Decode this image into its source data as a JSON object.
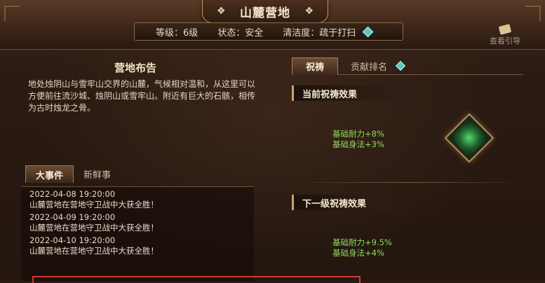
{
  "header": {
    "title": "山麓营地",
    "level": "等级：6级",
    "state": "状态：安全",
    "cleanliness": "清洁度：疏于打扫",
    "view_guide": "查看引导"
  },
  "left": {
    "notice_title": "营地布告",
    "notice_text": "地处烛阴山与雪牢山交界的山麓，气候相对温和，从这里可以方便前往流沙城、烛阴山或雪牢山。附近有巨大的石骸，相传为古时烛龙之骨。",
    "tabs": [
      "大事件",
      "新鲜事"
    ],
    "events": [
      {
        "time": "2022-04-08   19:20:00",
        "text": "山麓营地在营地守卫战中大获全胜！"
      },
      {
        "time": "2022-04-09   19:20:00",
        "text": "山麓营地在营地守卫战中大获全胜！"
      },
      {
        "time": "2022-04-10   19:20:00",
        "text": "山麓营地在营地守卫战中大获全胜！"
      }
    ]
  },
  "right": {
    "tabs": [
      "祝祷",
      "贡献排名"
    ],
    "current_title": "当前祝祷效果",
    "current_buffs": [
      "基础耐力+8%",
      "基础身法+3%"
    ],
    "next_title": "下一级祝祷效果",
    "next_buffs": [
      "基础耐力+9.5%",
      "基础身法+4%"
    ]
  },
  "colors": {
    "accent_gold": "#c79c63",
    "buff_green": "#8bdc5a",
    "alert_red": "#d23a30"
  }
}
